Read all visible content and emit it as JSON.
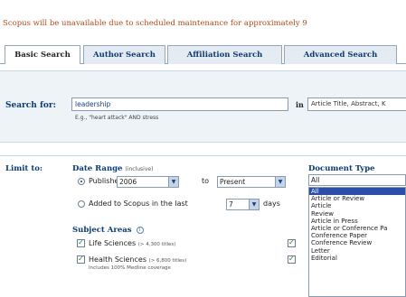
{
  "banner": {
    "message": "Scopus will be unavailable due to scheduled maintenance for approximately 9"
  },
  "tabs": [
    {
      "label": "Basic Search",
      "active": true
    },
    {
      "label": "Author Search",
      "active": false
    },
    {
      "label": "Affiliation Search",
      "active": false
    },
    {
      "label": "Advanced Search",
      "active": false
    }
  ],
  "search": {
    "label": "Search for:",
    "value": "leadership",
    "hint": "E.g., \"heart attack\" AND stress",
    "in_label": "in",
    "field_value": "Article Title, Abstract, K"
  },
  "limit": {
    "label": "Limit to:",
    "date_range_label": "Date Range",
    "inclusive_label": "(inclusive)",
    "published_label": "Published",
    "year_from": "2006",
    "to_label": "to",
    "year_to": "Present",
    "added_label": "Added to Scopus in the last",
    "days_value": "7",
    "days_label": "days"
  },
  "subject": {
    "label": "Subject Areas",
    "items": [
      {
        "label": "Life Sciences",
        "note": "(> 4,300 titles)",
        "sub": ""
      },
      {
        "label": "Health Sciences",
        "note": "(> 6,800 titles)",
        "sub": "Includes 100% Medline coverage"
      }
    ]
  },
  "doctype": {
    "label": "Document Type",
    "selected": "All",
    "options": [
      "All",
      "Article or Review",
      "Article",
      "Review",
      "Article in Press",
      "Article or Conference Pa",
      "Conference Paper",
      "Conference Review",
      "Letter",
      "Editorial"
    ]
  },
  "icons": {
    "dropdown": "chevron-down-icon",
    "info": "info-icon"
  },
  "colors": {
    "tab_text": "#0a3b72",
    "banner_text": "#b04a1c",
    "list_selected": "#2b4ea8"
  }
}
